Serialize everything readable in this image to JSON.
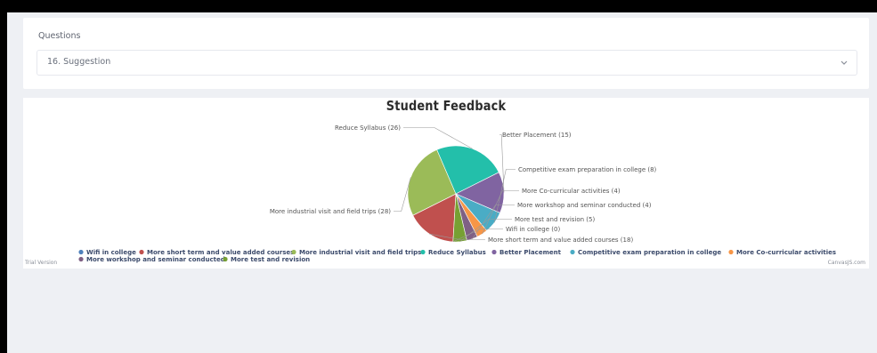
{
  "questions": {
    "label": "Questions",
    "selected": "16. Suggestion"
  },
  "chart_data": {
    "type": "pie",
    "title": "Student Feedback",
    "slices": [
      {
        "label": "Wifi in college",
        "value": 0,
        "color": "#4f81bc"
      },
      {
        "label": "More short term and value added courses",
        "value": 18,
        "color": "#c0504e"
      },
      {
        "label": "More industrial visit and field trips",
        "value": 28,
        "color": "#9bbb58"
      },
      {
        "label": "Reduce Syllabus",
        "value": 26,
        "color": "#23bfaa"
      },
      {
        "label": "Better Placement",
        "value": 15,
        "color": "#8064a1"
      },
      {
        "label": "Competitive exam preparation in college",
        "value": 8,
        "color": "#4aacc5"
      },
      {
        "label": "More Co-curricular activities",
        "value": 4,
        "color": "#f79647"
      },
      {
        "label": "More workshop and seminar conducted",
        "value": 4,
        "color": "#7f6084"
      },
      {
        "label": "More test and revision",
        "value": 5,
        "color": "#77a033"
      }
    ],
    "index_labels": [
      "Reduce Syllabus (26)",
      "Better Placement (15)",
      "Competitive exam preparation in college (8)",
      "More Co-curricular activities (4)",
      "More workshop and seminar conducted (4)",
      "More industrial visit and field trips (28)",
      "More test and revision (5)",
      "Wifi in college (0)",
      "More short term and value added courses (18)"
    ],
    "legend_position": "bottom"
  },
  "credits": {
    "trial": "Trial Version",
    "brand": "CanvasJS.com"
  },
  "icons": {
    "dropdown": "chevron-down-icon"
  }
}
